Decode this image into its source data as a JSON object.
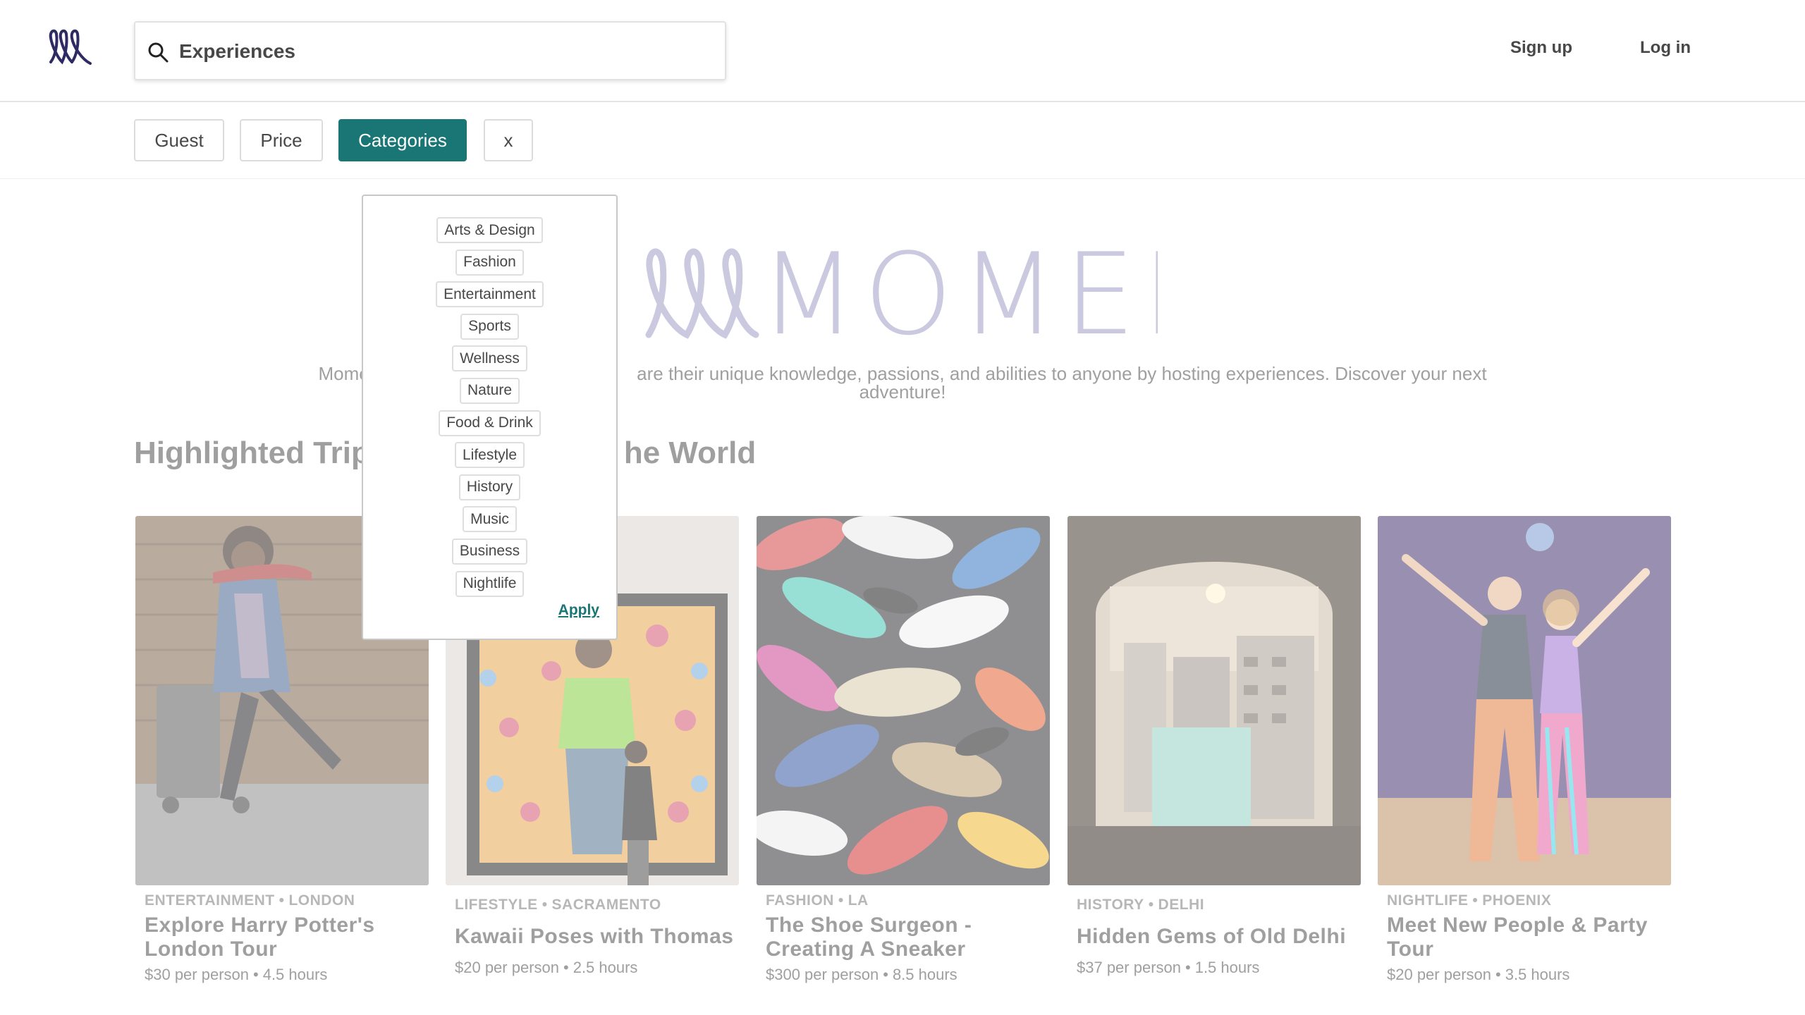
{
  "header": {
    "search": {
      "value": "Experiences",
      "placeholder": ""
    },
    "signup_label": "Sign up",
    "login_label": "Log in"
  },
  "filters": {
    "guest": "Guest",
    "price": "Price",
    "categories": "Categories",
    "clear": "x",
    "active": "Categories"
  },
  "dropdown": {
    "items": [
      "Arts & Design",
      "Fashion",
      "Entertainment",
      "Sports",
      "Wellness",
      "Nature",
      "Food & Drink",
      "Lifestyle",
      "History",
      "Music",
      "Business",
      "Nightlife"
    ],
    "apply_label": "Apply"
  },
  "hero": {
    "brand": "MOMENT",
    "tagline_left": "Momen",
    "tagline_right": "are their unique knowledge, passions, and abilities to anyone by hosting experiences. Discover your next",
    "tagline_line2": "adventure!"
  },
  "section": {
    "title_left": "Highlighted Trip",
    "title_right": "he World"
  },
  "cards": [
    {
      "category": "ENTERTAINMENT",
      "city": "LONDON",
      "title_l1": "Explore Harry Potter's",
      "title_l2": "London Tour",
      "price": "$30 per person",
      "duration": "4.5 hours"
    },
    {
      "category": "LIFESTYLE",
      "city": "SACRAMENTO",
      "title_l1": "Kawaii Poses with Thomas",
      "title_l2": "",
      "price": "$20 per person",
      "duration": "2.5 hours"
    },
    {
      "category": "FASHION",
      "city": "LA",
      "title_l1": "The Shoe Surgeon -",
      "title_l2": "Creating A Sneaker",
      "price": "$300 per person",
      "duration": "8.5 hours"
    },
    {
      "category": "HISTORY",
      "city": "DELHI",
      "title_l1": "Hidden Gems of Old Delhi",
      "title_l2": "",
      "price": "$37 per person",
      "duration": "1.5 hours"
    },
    {
      "category": "NIGHTLIFE",
      "city": "PHOENIX",
      "title_l1": "Meet New People & Party",
      "title_l2": "Tour",
      "price": "$20 per person",
      "duration": "3.5 hours"
    }
  ],
  "colors": {
    "accent": "#1a7575",
    "brand": "#2e2a63",
    "brand_light": "#9c97c4"
  },
  "icons": {
    "logo": "moment-logo-icon",
    "search": "search-icon"
  }
}
